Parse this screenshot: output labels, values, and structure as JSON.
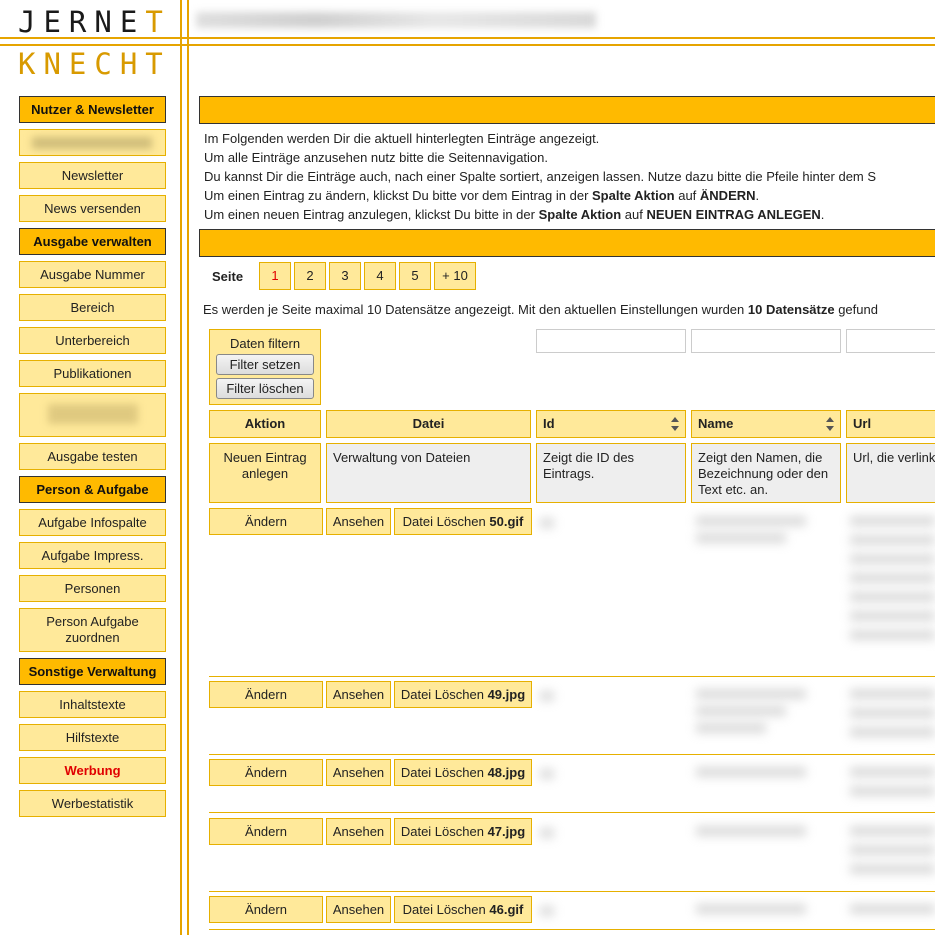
{
  "logo": {
    "line1": "JERNE",
    "line1b": "T",
    "line2": "KNECHT"
  },
  "sidebar": [
    {
      "label": "Nutzer & Newsletter",
      "kind": "head"
    },
    {
      "label": "",
      "kind": "blur"
    },
    {
      "label": "Newsletter",
      "kind": "item"
    },
    {
      "label": "News versenden",
      "kind": "item"
    },
    {
      "label": "Ausgabe verwalten",
      "kind": "head"
    },
    {
      "label": "Ausgabe Nummer",
      "kind": "item"
    },
    {
      "label": "Bereich",
      "kind": "item"
    },
    {
      "label": "Unterbereich",
      "kind": "item"
    },
    {
      "label": "Publikationen",
      "kind": "item"
    },
    {
      "label": "",
      "kind": "blurtall"
    },
    {
      "label": "Ausgabe testen",
      "kind": "item"
    },
    {
      "label": "Person & Aufgabe",
      "kind": "head"
    },
    {
      "label": "Aufgabe Infospalte",
      "kind": "item"
    },
    {
      "label": "Aufgabe Impress.",
      "kind": "item"
    },
    {
      "label": "Personen",
      "kind": "item"
    },
    {
      "label": "Person Aufgabe zuordnen",
      "kind": "tall"
    },
    {
      "label": "Sonstige Verwaltung",
      "kind": "head"
    },
    {
      "label": "Inhaltstexte",
      "kind": "item"
    },
    {
      "label": "Hilfstexte",
      "kind": "item"
    },
    {
      "label": "Werbung",
      "kind": "red"
    },
    {
      "label": "Werbestatistik",
      "kind": "item"
    }
  ],
  "intro": {
    "line1": "Im Folgenden werden Dir die aktuell hinterlegten Einträge angezeigt.",
    "line2": "Um alle Einträge anzusehen nutz bitte die Seitennavigation.",
    "line3": "Du kannst Dir die Einträge auch, nach einer Spalte sortiert, anzeigen lassen. Nutze dazu bitte die Pfeile hinter dem S",
    "line4_a": "Um einen Eintrag zu ändern, klickst Du bitte vor dem Eintrag in der ",
    "line4_b": "Spalte Aktion",
    "line4_c": " auf ",
    "line4_d": "ÄNDERN",
    "line4_e": ".",
    "line5_a": "Um einen neuen Eintrag anzulegen, klickst Du bitte in der ",
    "line5_b": "Spalte Aktion",
    "line5_c": " auf ",
    "line5_d": "NEUEN EINTRAG ANLEGEN",
    "line5_e": "."
  },
  "pager": {
    "label": "Seite",
    "pages": [
      "1",
      "2",
      "3",
      "4",
      "5",
      "+ 10"
    ],
    "active": "1"
  },
  "info": {
    "text_a": "Es werden je Seite maximal 10 Datensätze angezeigt. Mit den aktuellen Einstellungen wurden ",
    "text_b": "10 Datensätze",
    "text_c": " gefund"
  },
  "filter": {
    "title": "Daten filtern",
    "set": "Filter setzen",
    "clear": "Filter löschen"
  },
  "columns": {
    "aktion": "Aktion",
    "datei": "Datei",
    "id": "Id",
    "name": "Name",
    "url": "Url"
  },
  "descriptions": {
    "aktion": "Neuen Eintrag anlegen",
    "datei": "Verwaltung von Dateien",
    "id": "Zeigt die ID des Eintrags.",
    "name": "Zeigt den Namen, die Bezeichnung oder den Text etc. an.",
    "url": "Url, die verlinkt"
  },
  "row_actions": {
    "edit": "Ändern",
    "view": "Ansehen",
    "delete_prefix": "Datei Löschen "
  },
  "rows": [
    {
      "file": "50.gif"
    },
    {
      "file": "49.jpg"
    },
    {
      "file": "48.jpg"
    },
    {
      "file": "47.jpg"
    },
    {
      "file": "46.gif"
    }
  ]
}
